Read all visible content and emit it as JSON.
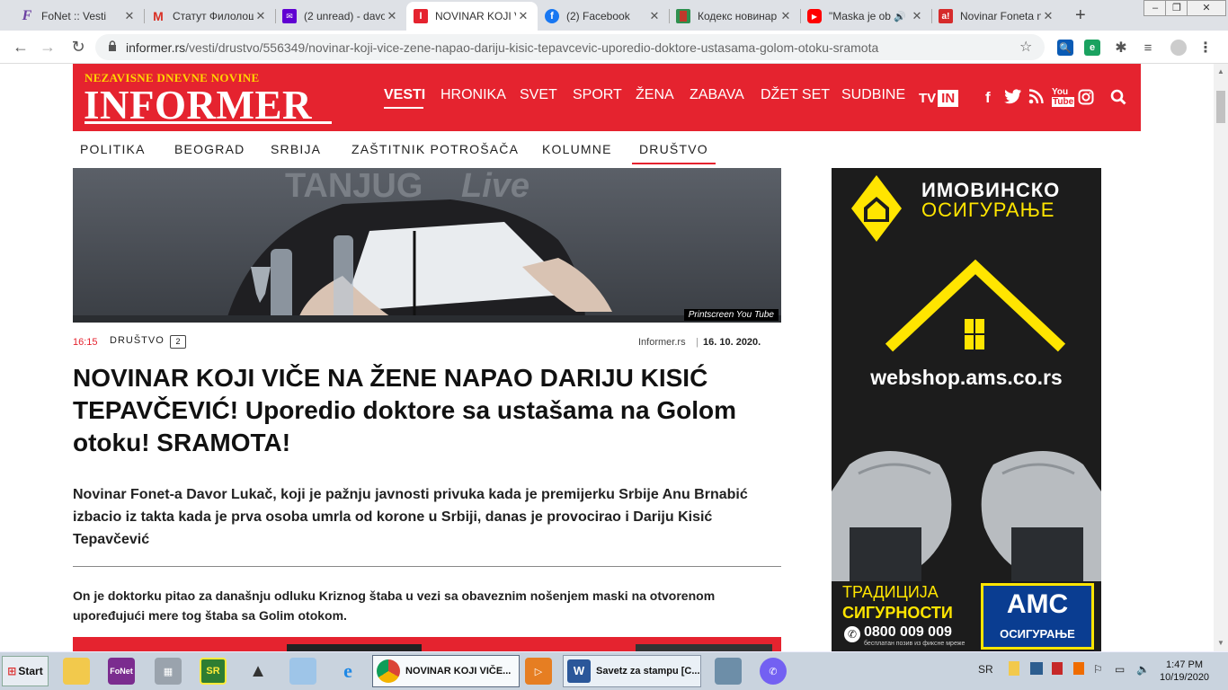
{
  "browser": {
    "tabs": [
      {
        "title": "FoNet :: Vesti",
        "icon": "fonet-f",
        "color": "#6a3ea1"
      },
      {
        "title": "Статут Филолош",
        "icon": "gmail-m",
        "color": "#d93025"
      },
      {
        "title": "(2 unread) - davo",
        "icon": "yahoo-mail",
        "color": "#6001d2"
      },
      {
        "title": "NOVINAR KOJI V",
        "icon": "informer-i",
        "color": "#e5232f"
      },
      {
        "title": "(2) Facebook",
        "icon": "facebook-f",
        "color": "#1877f2"
      },
      {
        "title": "Кодекс новинар",
        "icon": "kodeks-book",
        "color": "#c0392b"
      },
      {
        "title": "\"Maska je ob",
        "icon": "youtube-play",
        "color": "#ff0000"
      },
      {
        "title": "Novinar Foneta n",
        "icon": "alo-a",
        "color": "#d62b2b"
      }
    ],
    "new_tab": "+",
    "url_host": "informer.rs",
    "url_path": "/vesti/drustvo/556349/novinar-koji-vice-zene-napao-dariju-kisic-tepavcevic-uporedio-doktore-ustasama-golom-otoku-sramota"
  },
  "site": {
    "logo_top": "NEZAVISNE DNEVNE NOVINE",
    "logo_main": "INFORMER",
    "nav": [
      "VESTI",
      "HRONIKA",
      "SVET",
      "SPORT",
      "ŽENA",
      "ZABAVA",
      "DŽET SET",
      "SUDBINE"
    ],
    "tv_label": "TV",
    "tv_badge": "IN",
    "subnav": [
      "POLITIKA",
      "BEOGRAD",
      "SRBIJA",
      "ZAŠTITNIK POTROŠAČA",
      "KOLUMNE",
      "DRUŠTVO"
    ]
  },
  "article": {
    "hero_overlay": "TANJUG Live",
    "credit": "Printscreen You Tube",
    "time": "16:15",
    "category": "DRUŠTVO",
    "comments": "2",
    "source": "Informer.rs",
    "date": "16. 10. 2020.",
    "title": "NOVINAR KOJI VIČE NA ŽENE NAPAO DARIJU KISIĆ TEPAVČEVIĆ! Uporedio doktore sa ustašama na Golom otoku! SRAMOTA!",
    "lead": "Novinar Fonet-a Davor Lukač, koji je pažnju javnosti privuka kada je premijerku Srbije Anu Brnabić izbacio iz takta kada je prva osoba umrla od korone u Srbiji, danas je provocirao i Dariju Kisić Tepavčević",
    "body": "On je doktorku pitao za današnju odluku Kriznog štaba u vezi sa obaveznim nošenjem maski na otvorenom upoređujući mere tog štaba sa Golim otokom."
  },
  "ad": {
    "line1": "ИМОВИНСКО",
    "line2": "ОСИГУРАЊЕ",
    "web": "webshop.ams.co.rs",
    "trad1": "ТРАДИЦИЈА",
    "trad2": "СИГУРНОСТИ",
    "phone": "0800 009 009",
    "phone_note": "бесплатан позив из фиксне мреже",
    "brand": "АМС",
    "brand_sub": "ОСИГУРАЊЕ"
  },
  "taskbar": {
    "start": "Start",
    "tasks": [
      "NOVINAR KOJI VIČE...",
      "Savetz za stampu [C..."
    ],
    "quick_icons": [
      "FoNet",
      "SR"
    ],
    "lang": "SR",
    "time": "1:47 PM",
    "date": "10/19/2020"
  }
}
